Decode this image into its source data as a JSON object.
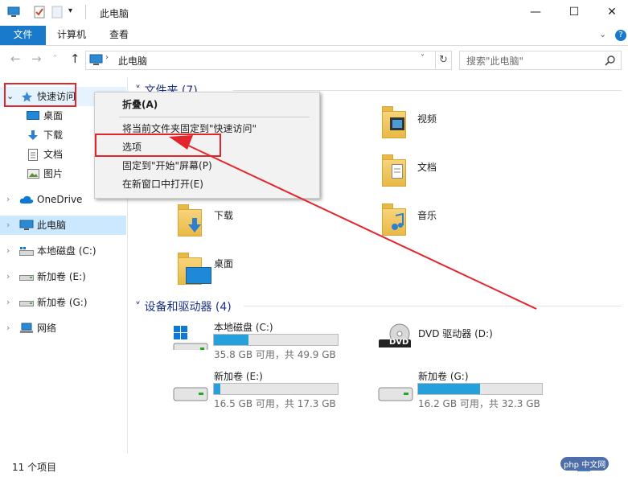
{
  "window": {
    "title": "此电脑",
    "controls": [
      "minimize",
      "maximize",
      "close"
    ]
  },
  "ribbon": {
    "tabs": [
      "文件",
      "计算机",
      "查看"
    ]
  },
  "address_bar": {
    "path": "此电脑",
    "search_placeholder": "搜索\"此电脑\""
  },
  "sidebar": {
    "items": [
      {
        "label": "快速访问",
        "icon": "star-icon"
      },
      {
        "label": "桌面",
        "icon": "desktop-icon"
      },
      {
        "label": "下载",
        "icon": "download-icon"
      },
      {
        "label": "文档",
        "icon": "document-icon"
      },
      {
        "label": "图片",
        "icon": "picture-icon"
      },
      {
        "label": "OneDrive",
        "icon": "cloud-icon"
      },
      {
        "label": "此电脑",
        "icon": "computer-icon"
      },
      {
        "label": "本地磁盘 (C:)",
        "icon": "drive-icon"
      },
      {
        "label": "新加卷 (E:)",
        "icon": "drive-icon"
      },
      {
        "label": "新加卷 (G:)",
        "icon": "drive-icon"
      },
      {
        "label": "网络",
        "icon": "network-icon"
      }
    ]
  },
  "folders_section": {
    "title": "文件夹 (7)",
    "items": [
      "视频",
      "文档",
      "下载",
      "音乐",
      "桌面"
    ]
  },
  "devices_section": {
    "title": "设备和驱动器 (4)",
    "drives": [
      {
        "name": "本地磁盘 (C:)",
        "free": "35.8 GB 可用，共 49.9 GB",
        "used_fraction": 0.28
      },
      {
        "name": "DVD 驱动器 (D:)",
        "badge": "DVD"
      },
      {
        "name": "新加卷 (E:)",
        "free": "16.5 GB 可用，共 17.3 GB",
        "used_fraction": 0.05
      },
      {
        "name": "新加卷 (G:)",
        "free": "16.2 GB 可用，共 32.3 GB",
        "used_fraction": 0.5
      }
    ]
  },
  "context_menu": {
    "items": [
      "折叠(A)",
      "将当前文件夹固定到\"快速访问\"",
      "选项",
      "固定到\"开始\"屏幕(P)",
      "在新窗口中打开(E)"
    ]
  },
  "status_bar": {
    "count": "11 个项目"
  },
  "watermark": {
    "text": "php 中文网"
  },
  "colors": {
    "accent": "#1979ca",
    "selection": "#cce8ff",
    "annotation": "#e3262c",
    "bar_fill": "#26a0da"
  }
}
